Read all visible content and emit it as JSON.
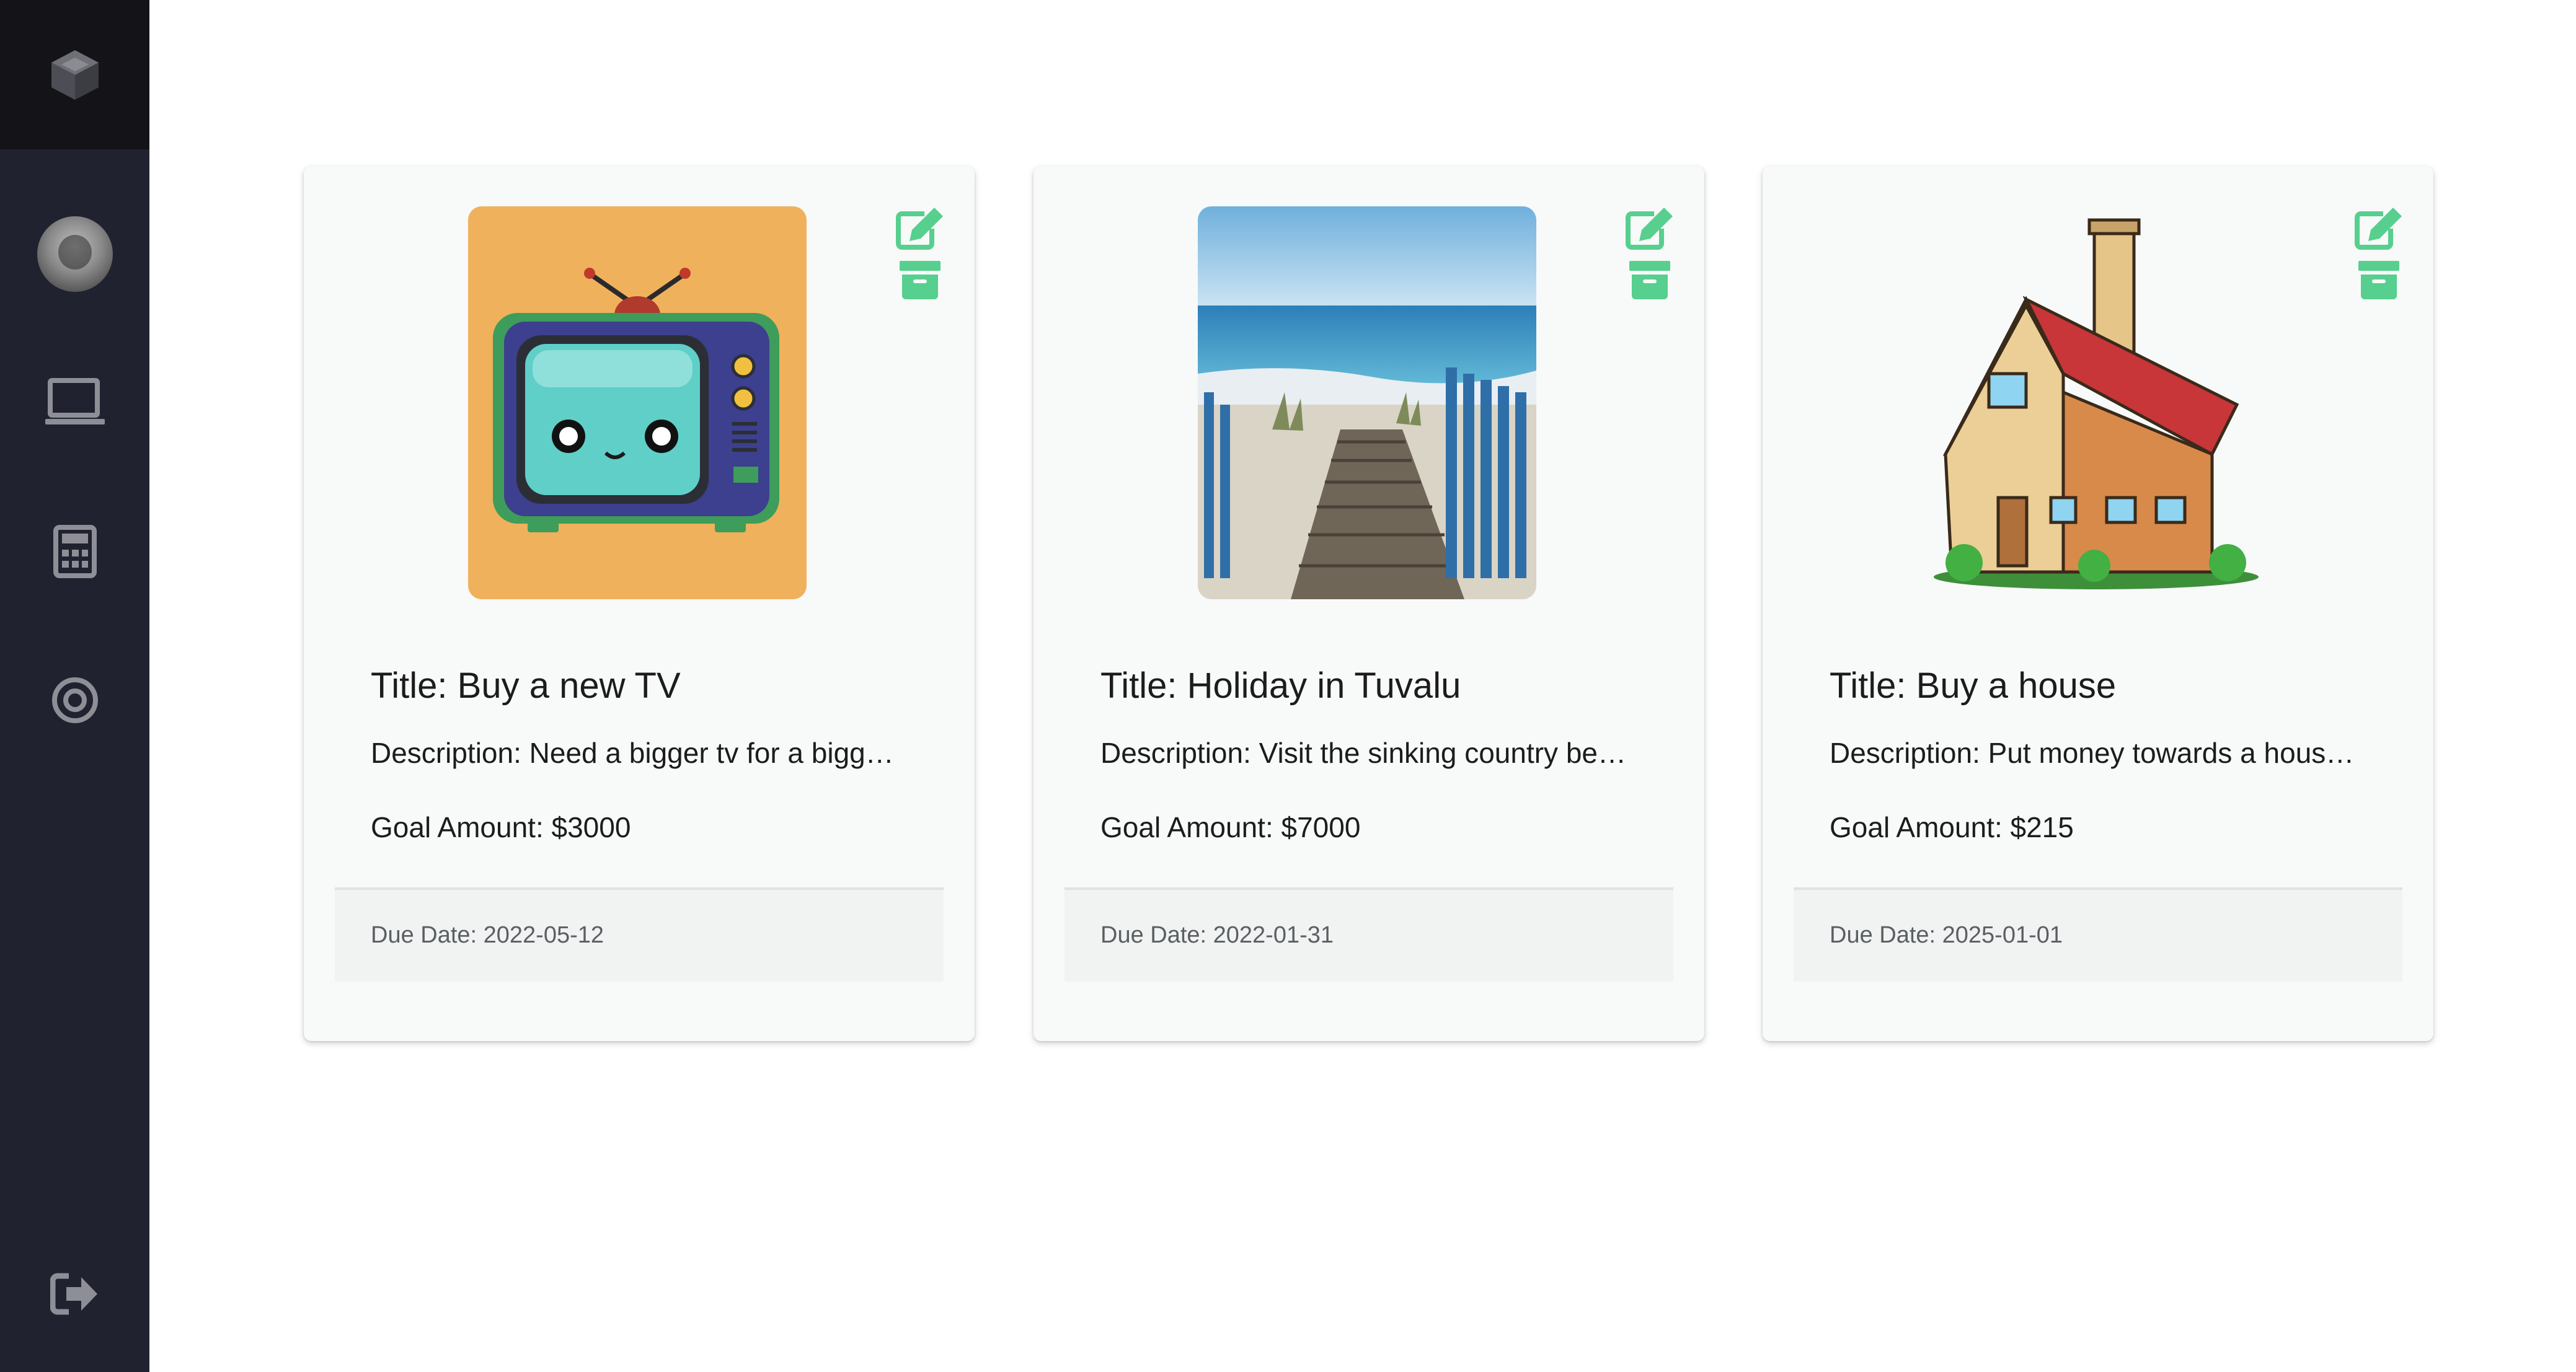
{
  "sidebar": {
    "logo_icon": "cube-logo-icon",
    "items": [
      {
        "name": "profile-avatar",
        "icon": "avatar"
      },
      {
        "name": "dashboard",
        "icon": "monitor-icon"
      },
      {
        "name": "budget-calculator",
        "icon": "calculator-icon"
      },
      {
        "name": "goals",
        "icon": "target-icon"
      }
    ],
    "logout_icon": "logout-icon"
  },
  "colors": {
    "sidebar_bg": "#212230",
    "logo_bg": "#141418",
    "accent_green": "#57cf8e"
  },
  "goals": [
    {
      "title": "Title: Buy a new TV",
      "description": "Description: Need a bigger tv for a bigger room",
      "goal_amount": "Goal Amount: $3000",
      "due_date": "Due Date: 2022-05-12",
      "image": "retro-tv-illustration"
    },
    {
      "title": "Title: Holiday in Tuvalu",
      "description": "Description: Visit the sinking country before it is gone",
      "goal_amount": "Goal Amount: $7000",
      "due_date": "Due Date: 2022-01-31",
      "image": "beach-boardwalk-painting"
    },
    {
      "title": "Title: Buy a house",
      "description": "Description: Put money towards a house deposit",
      "goal_amount": "Goal Amount: $215",
      "due_date": "Due Date: 2025-01-01",
      "image": "cartoon-house-illustration"
    }
  ]
}
